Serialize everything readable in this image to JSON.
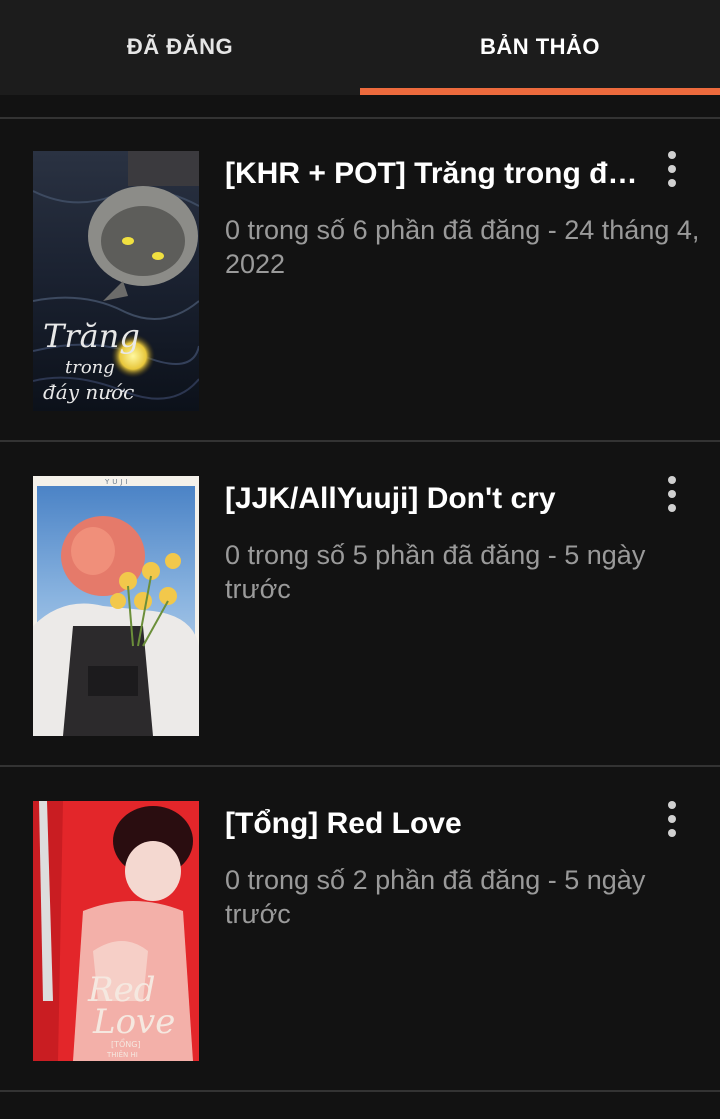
{
  "tabs": [
    {
      "label": "ĐÃ ĐĂNG",
      "active": false
    },
    {
      "label": "BẢN THẢO",
      "active": true
    }
  ],
  "accent_color": "#ec6a3d",
  "stories": [
    {
      "title": "[KHR + POT] Trăng trong đá...",
      "meta": "0 trong số 6 phần đã đăng - 24 tháng 4, 2022",
      "cover_text": [
        "Trăng",
        "trong",
        "đáy nước"
      ]
    },
    {
      "title": "[JJK/AllYuuji] Don't cry",
      "meta": "0 trong số 5 phần đã đăng - 5 ngày trước",
      "cover_text": [
        "YUJI"
      ]
    },
    {
      "title": "[Tổng] Red Love",
      "meta": "0 trong số 2 phần đã đăng - 5 ngày trước",
      "cover_text": [
        "Red",
        "Love",
        "[TỔNG]",
        "THIÊN HI"
      ]
    }
  ]
}
